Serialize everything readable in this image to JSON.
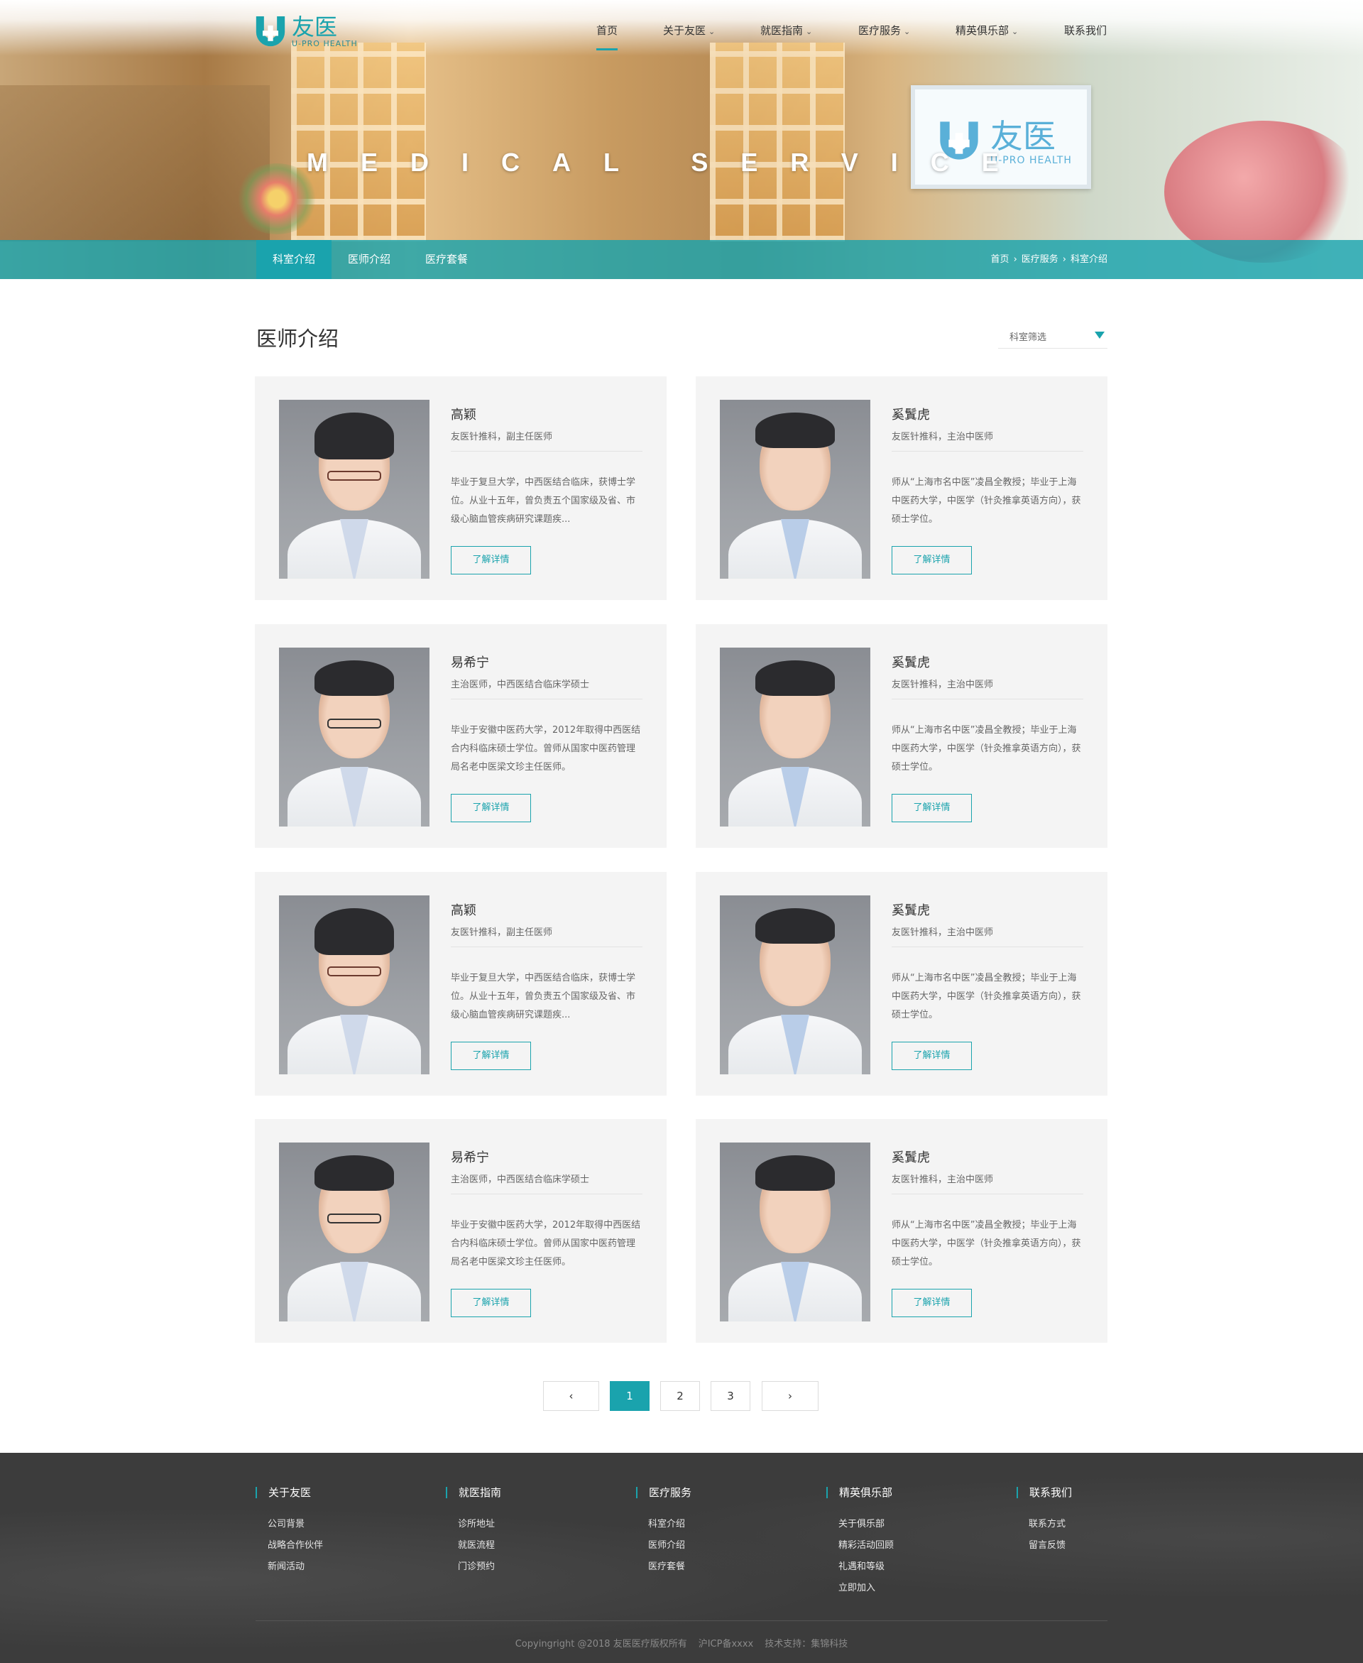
{
  "brand": {
    "name": "友医",
    "sub": "U-PRO HEALTH"
  },
  "nav": [
    {
      "label": "首页",
      "dropdown": false,
      "active": true
    },
    {
      "label": "关于友医",
      "dropdown": true
    },
    {
      "label": "就医指南",
      "dropdown": true
    },
    {
      "label": "医疗服务",
      "dropdown": true
    },
    {
      "label": "精英俱乐部",
      "dropdown": true
    },
    {
      "label": "联系我们",
      "dropdown": false
    }
  ],
  "hero": {
    "tagline": "MEDICAL SERVICE",
    "screen_brand": "友医",
    "screen_sub": "U-PRO HEALTH"
  },
  "subnav": {
    "tabs": [
      "科室介绍",
      "医师介绍",
      "医疗套餐"
    ],
    "active_tab": 0,
    "breadcrumb": [
      "首页",
      "医疗服务",
      "科室介绍"
    ]
  },
  "page": {
    "title": "医师介绍",
    "filter_label": "科室筛选"
  },
  "doctors": [
    {
      "name": "高颖",
      "title": "友医针推科，副主任医师",
      "bio": "毕业于复旦大学，中西医结合临床，获博士学位。从业十五年，曾负责五个国家级及省、市级心脑血管疾病研究课题疾...",
      "button": "了解详情",
      "avatar": "female-doctor"
    },
    {
      "name": "奚鬒虎",
      "title": "友医针推科，主治中医师",
      "bio": "师从“上海市名中医”凌昌全教授；毕业于上海中医药大学，中医学（针灸推拿英语方向），获硕士学位。",
      "button": "了解详情",
      "avatar": "young-male-doctor"
    },
    {
      "name": "易希宁",
      "title": "主治医师，中西医结合临床学硕士",
      "bio": "毕业于安徽中医药大学，2012年取得中西医结合内科临床硕士学位。曾师从国家中医药管理局名老中医梁文珍主任医师。",
      "button": "了解详情",
      "avatar": "male-doctor-glasses"
    },
    {
      "name": "奚鬒虎",
      "title": "友医针推科，主治中医师",
      "bio": "师从“上海市名中医”凌昌全教授；毕业于上海中医药大学，中医学（针灸推拿英语方向），获硕士学位。",
      "button": "了解详情",
      "avatar": "young-male-doctor"
    },
    {
      "name": "高颖",
      "title": "友医针推科，副主任医师",
      "bio": "毕业于复旦大学，中西医结合临床，获博士学位。从业十五年，曾负责五个国家级及省、市级心脑血管疾病研究课题疾...",
      "button": "了解详情",
      "avatar": "female-doctor"
    },
    {
      "name": "奚鬒虎",
      "title": "友医针推科，主治中医师",
      "bio": "师从“上海市名中医”凌昌全教授；毕业于上海中医药大学，中医学（针灸推拿英语方向），获硕士学位。",
      "button": "了解详情",
      "avatar": "young-male-doctor"
    },
    {
      "name": "易希宁",
      "title": "主治医师，中西医结合临床学硕士",
      "bio": "毕业于安徽中医药大学，2012年取得中西医结合内科临床硕士学位。曾师从国家中医药管理局名老中医梁文珍主任医师。",
      "button": "了解详情",
      "avatar": "male-doctor-glasses"
    },
    {
      "name": "奚鬒虎",
      "title": "友医针推科，主治中医师",
      "bio": "师从“上海市名中医”凌昌全教授；毕业于上海中医药大学，中医学（针灸推拿英语方向），获硕士学位。",
      "button": "了解详情",
      "avatar": "young-male-doctor"
    }
  ],
  "pagination": {
    "prev": "‹",
    "pages": [
      "1",
      "2",
      "3"
    ],
    "current": "1",
    "next": "›"
  },
  "footer": {
    "columns": [
      {
        "title": "关于友医",
        "links": [
          "公司背景",
          "战略合作伙伴",
          "新闻活动"
        ]
      },
      {
        "title": "就医指南",
        "links": [
          "诊所地址",
          "就医流程",
          "门诊预约"
        ]
      },
      {
        "title": "医疗服务",
        "links": [
          "科室介绍",
          "医师介绍",
          "医疗套餐"
        ]
      },
      {
        "title": "精英俱乐部",
        "links": [
          "关于俱乐部",
          "精彩活动回顾",
          "礼遇和等级",
          "立即加入"
        ]
      },
      {
        "title": "联系我们",
        "links": [
          "联系方式",
          "留言反馈"
        ]
      }
    ],
    "copyright": "Copyingright @2018 友医医疗版权所有",
    "icp": "沪ICP备xxxx",
    "support": "技术支持：集锦科技"
  },
  "colors": {
    "accent": "#1aa3ad",
    "card_bg": "#f4f4f4",
    "footer_bg": "#3c3c3c"
  }
}
